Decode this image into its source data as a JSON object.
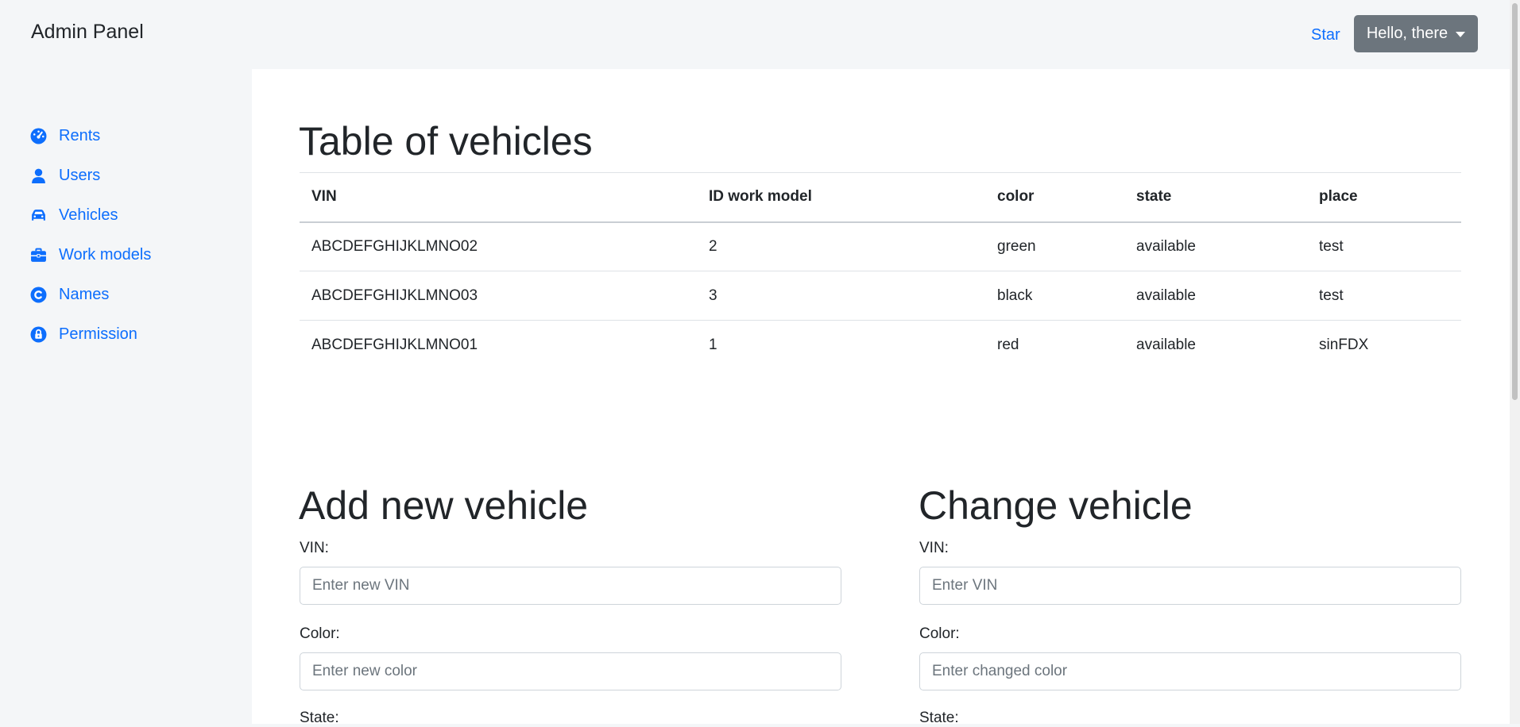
{
  "header": {
    "brand": "Admin Panel",
    "star_link": "Star",
    "user_button": "Hello, there"
  },
  "sidebar": {
    "items": [
      {
        "label": "Rents",
        "icon": "dashboard-gauge-icon"
      },
      {
        "label": "Users",
        "icon": "user-icon"
      },
      {
        "label": "Vehicles",
        "icon": "car-icon"
      },
      {
        "label": "Work models",
        "icon": "briefcase-icon"
      },
      {
        "label": "Names",
        "icon": "copyright-icon"
      },
      {
        "label": "Permission",
        "icon": "lock-icon"
      }
    ]
  },
  "vehicles_table": {
    "title": "Table of vehicles",
    "columns": [
      "VIN",
      "ID work model",
      "color",
      "state",
      "place"
    ],
    "rows": [
      [
        "ABCDEFGHIJKLMNO02",
        "2",
        "green",
        "available",
        "test"
      ],
      [
        "ABCDEFGHIJKLMNO03",
        "3",
        "black",
        "available",
        "test"
      ],
      [
        "ABCDEFGHIJKLMNO01",
        "1",
        "red",
        "available",
        "sinFDX"
      ]
    ]
  },
  "add_form": {
    "title": "Add new vehicle",
    "vin_label": "VIN:",
    "vin_placeholder": "Enter new VIN",
    "color_label": "Color:",
    "color_placeholder": "Enter new color",
    "state_label": "State:"
  },
  "change_form": {
    "title": "Change vehicle",
    "vin_label": "VIN:",
    "vin_placeholder": "Enter VIN",
    "color_label": "Color:",
    "color_placeholder": "Enter changed color",
    "state_label": "State:"
  },
  "colors": {
    "link": "#0d6efd",
    "secondary_button": "#6c757d",
    "background": "#f4f6f8"
  }
}
